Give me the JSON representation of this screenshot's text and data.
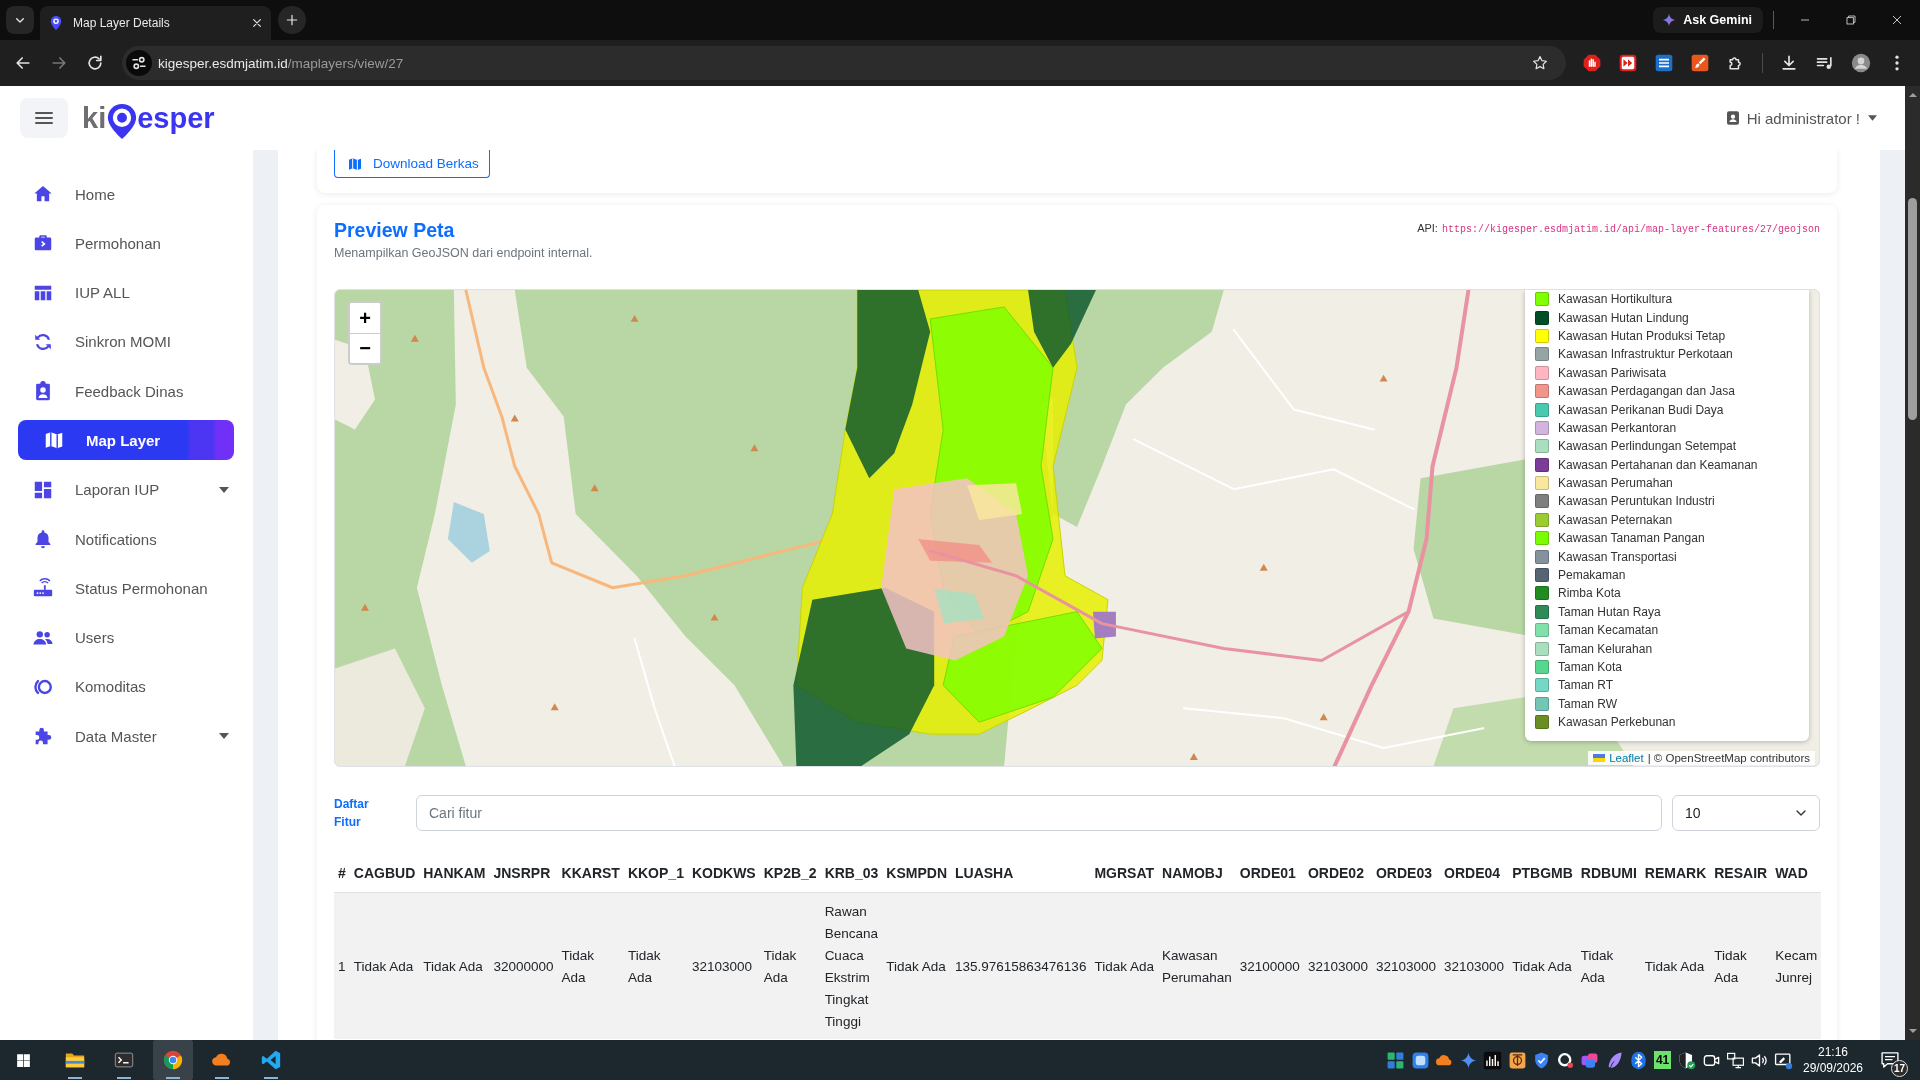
{
  "browser": {
    "tabs": [
      {
        "title": "Map Layer Details",
        "selected": true
      }
    ],
    "assistant_button": "Ask Gemini",
    "address": {
      "domain": "kigesper.esdmjatim.id",
      "path": "/maplayers/view/27"
    }
  },
  "header": {
    "logo": {
      "before_pin": "ki",
      "after_pin": "esper"
    },
    "user_menu": "Hi administrator !"
  },
  "sidebar": {
    "items": [
      {
        "label": "Home",
        "selected": false,
        "has_submenu": false
      },
      {
        "label": "Permohonan",
        "selected": false,
        "has_submenu": false
      },
      {
        "label": "IUP ALL",
        "selected": false,
        "has_submenu": false
      },
      {
        "label": "Sinkron MOMI",
        "selected": false,
        "has_submenu": false
      },
      {
        "label": "Feedback Dinas",
        "selected": false,
        "has_submenu": false
      },
      {
        "label": "Map Layer",
        "selected": true,
        "has_submenu": false
      },
      {
        "label": "Laporan IUP",
        "selected": false,
        "has_submenu": true
      },
      {
        "label": "Notifications",
        "selected": false,
        "has_submenu": false
      },
      {
        "label": "Status Permohonan",
        "selected": false,
        "has_submenu": false
      },
      {
        "label": "Users",
        "selected": false,
        "has_submenu": false
      },
      {
        "label": "Komoditas",
        "selected": false,
        "has_submenu": false
      },
      {
        "label": "Data Master",
        "selected": false,
        "has_submenu": true
      }
    ]
  },
  "download_card": {
    "button": "Download Berkas"
  },
  "preview": {
    "title": "Preview Peta",
    "subtitle": "Menampilkan GeoJSON dari endpoint internal.",
    "api_label": "API:",
    "api_url": "https://kigesper.esdmjatim.id/api/map-layer-features/27/geojson",
    "map": {
      "zoom_in": "+",
      "zoom_out": "−",
      "legend": [
        {
          "label": "Kawasan Hortikultura",
          "color": "#7fff00"
        },
        {
          "label": "Kawasan Hutan Lindung",
          "color": "#004d26"
        },
        {
          "label": "Kawasan Hutan Produksi Tetap",
          "color": "#ffff00"
        },
        {
          "label": "Kawasan Infrastruktur Perkotaan",
          "color": "#95a5a6"
        },
        {
          "label": "Kawasan Pariwisata",
          "color": "#ffb6c1"
        },
        {
          "label": "Kawasan Perdagangan dan Jasa",
          "color": "#f1948a"
        },
        {
          "label": "Kawasan Perikanan Budi Daya",
          "color": "#48c9b0"
        },
        {
          "label": "Kawasan Perkantoran",
          "color": "#d2b4de"
        },
        {
          "label": "Kawasan Perlindungan Setempat",
          "color": "#a9dfbf"
        },
        {
          "label": "Kawasan Pertahanan dan Keamanan",
          "color": "#7d3c98"
        },
        {
          "label": "Kawasan Perumahan",
          "color": "#f9e79f"
        },
        {
          "label": "Kawasan Peruntukan Industri",
          "color": "#7f7f7f"
        },
        {
          "label": "Kawasan Peternakan",
          "color": "#9acd32"
        },
        {
          "label": "Kawasan Tanaman Pangan",
          "color": "#7cfc00"
        },
        {
          "label": "Kawasan Transportasi",
          "color": "#85929e"
        },
        {
          "label": "Pemakaman",
          "color": "#566573"
        },
        {
          "label": "Rimba Kota",
          "color": "#228b22"
        },
        {
          "label": "Taman Hutan Raya",
          "color": "#2e8b57"
        },
        {
          "label": "Taman Kecamatan",
          "color": "#82e0aa"
        },
        {
          "label": "Taman Kelurahan",
          "color": "#a9dfbf"
        },
        {
          "label": "Taman Kota",
          "color": "#58d68d"
        },
        {
          "label": "Taman RT",
          "color": "#76d7c4"
        },
        {
          "label": "Taman RW",
          "color": "#73c6b6"
        },
        {
          "label": "Kawasan Perkebunan",
          "color": "#6b8e23"
        }
      ],
      "attribution": {
        "link": "Leaflet",
        "text": "| © OpenStreetMap contributors"
      }
    }
  },
  "features": {
    "label": "Daftar Fitur",
    "search": {
      "placeholder": "Cari fitur"
    },
    "page_size": "10",
    "table": {
      "columns": [
        "#",
        "CAGBUD",
        "HANKAM",
        "JNSRPR",
        "KKARST",
        "KKOP_1",
        "KODKWS",
        "KP2B_2",
        "KRB_03",
        "KSMPDN",
        "LUASHA",
        "MGRSAT",
        "NAMOBJ",
        "ORDE01",
        "ORDE02",
        "ORDE03",
        "ORDE04",
        "PTBGMB",
        "RDBUMI",
        "REMARK",
        "RESAIR",
        "WAD"
      ],
      "rows": [
        [
          "1",
          "Tidak Ada",
          "Tidak Ada",
          "32000000",
          "Tidak Ada",
          "Tidak Ada",
          "32103000",
          "Tidak Ada",
          "Rawan Bencana Cuaca Ekstrim Tingkat Tinggi",
          "Tidak Ada",
          "135.97615863476136",
          "Tidak Ada",
          "Kawasan Perumahan",
          "32100000",
          "32103000",
          "32103000",
          "32103000",
          "Tidak Ada",
          "Tidak Ada",
          "Tidak Ada",
          "Tidak Ada",
          "Kecam Junrej"
        ]
      ]
    }
  },
  "taskbar": {
    "apps": [
      {
        "selected": false,
        "running": true
      },
      {
        "selected": false,
        "running": true
      },
      {
        "selected": true,
        "running": true
      },
      {
        "selected": false,
        "running": true
      },
      {
        "selected": false,
        "running": true
      }
    ],
    "tray_badge": "41",
    "time": "21:16",
    "date": "29/09/2026",
    "notification_count": "17"
  }
}
